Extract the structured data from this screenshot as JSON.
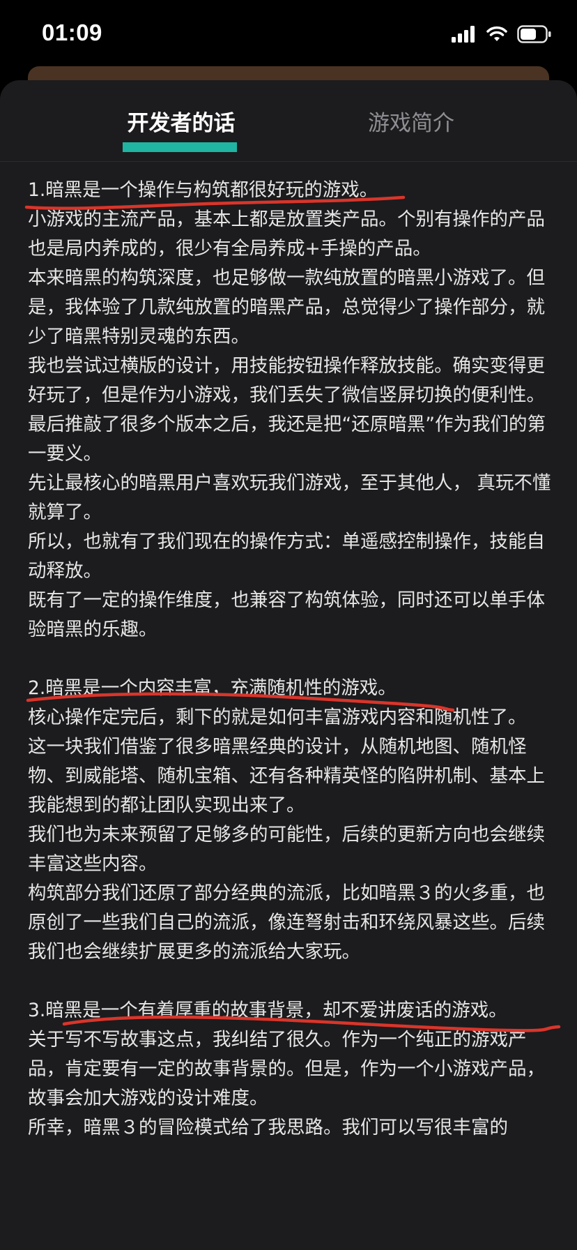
{
  "status_bar": {
    "time": "01:09",
    "icons": [
      "cellular-signal-icon",
      "wifi-icon",
      "battery-icon"
    ]
  },
  "tabs": [
    {
      "label": "开发者的话",
      "active": true
    },
    {
      "label": "游戏简介",
      "active": false
    }
  ],
  "colors": {
    "tab_accent": "#1fb5a2",
    "annotation_red": "#d9352b",
    "sheet_background": "#1c1c1e"
  },
  "sections": [
    {
      "heading": "1.暗黑是一个操作与构筑都很好玩的游戏。",
      "paragraphs": [
        "小游戏的主流产品，基本上都是放置类产品。个别有操作的产品也是局内养成的，很少有全局养成+手操的产品。",
        "本来暗黑的构筑深度，也足够做一款纯放置的暗黑小游戏了。但是，我体验了几款纯放置的暗黑产品，总觉得少了操作部分，就少了暗黑特别灵魂的东西。",
        "我也尝试过横版的设计，用技能按钮操作释放技能。确实变得更好玩了，但是作为小游戏，我们丢失了微信竖屏切换的便利性。",
        "最后推敲了很多个版本之后，我还是把“还原暗黑”作为我们的第一要义。",
        "先让最核心的暗黑用户喜欢玩我们游戏，至于其他人， 真玩不懂就算了。",
        "所以，也就有了我们现在的操作方式：单遥感控制操作，技能自动释放。",
        "既有了一定的操作维度，也兼容了构筑体验，同时还可以单手体验暗黑的乐趣。"
      ]
    },
    {
      "heading": "2.暗黑是一个内容丰富，充满随机性的游戏。",
      "paragraphs": [
        "核心操作定完后，剩下的就是如何丰富游戏内容和随机性了。",
        "这一块我们借鉴了很多暗黑经典的设计，从随机地图、随机怪物、到威能塔、随机宝箱、还有各种精英怪的陷阱机制、基本上我能想到的都让团队实现出来了。",
        "我们也为未来预留了足够多的可能性，后续的更新方向也会继续丰富这些内容。",
        "构筑部分我们还原了部分经典的流派，比如暗黑３的火多重，也原创了一些我们自己的流派，像连弩射击和环绕风暴这些。后续我们也会继续扩展更多的流派给大家玩。"
      ]
    },
    {
      "heading": "3.暗黑是一个有着厚重的故事背景，却不爱讲废话的游戏。",
      "paragraphs": [
        "关于写不写故事这点，我纠结了很久。作为一个纯正的游戏产品，肯定要有一定的故事背景的。但是，作为一个小游戏产品， 故事会加大游戏的设计难度。",
        "所幸，暗黑３的冒险模式给了我思路。我们可以写很丰富的"
      ]
    }
  ]
}
